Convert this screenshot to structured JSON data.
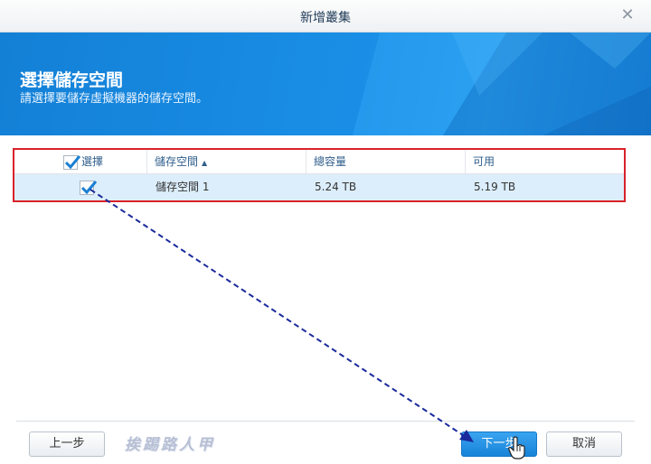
{
  "window": {
    "title": "新增叢集"
  },
  "banner": {
    "heading": "選擇儲存空間",
    "subtitle": "請選擇要儲存虛擬機器的儲存空間。"
  },
  "table": {
    "columns": {
      "select": "選擇",
      "volume": "儲存空間",
      "capacity": "總容量",
      "available": "可用"
    },
    "rows": [
      {
        "selected": true,
        "volume": "儲存空間 1",
        "capacity": "5.24 TB",
        "available": "5.19 TB"
      }
    ]
  },
  "footer": {
    "back_label": "上一步",
    "next_label": "下一步",
    "cancel_label": "取消",
    "watermark": "挨踢路人甲"
  },
  "colors": {
    "accent": "#1a8ee6",
    "highlight_border": "#d9222a",
    "selected_row": "#dceefb",
    "annotation_arrow": "#1a2a9c"
  }
}
